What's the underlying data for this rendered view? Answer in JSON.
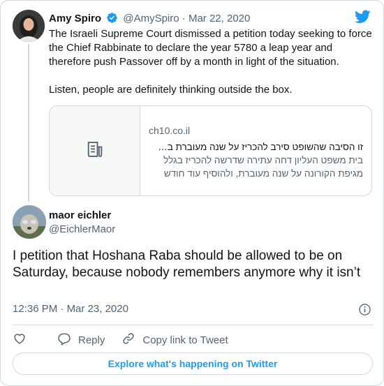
{
  "original_tweet": {
    "author_name": "Amy Spiro",
    "handle": "@AmySpiro",
    "separator": "·",
    "date": "Mar 22, 2020",
    "text": "The Israeli Supreme Court dismissed a petition today seeking to force the Chief Rabbinate to declare the year 5780 a leap year and therefore push Passover off by a month in light of the situation.\n\nListen, people are definitely thinking outside the box.",
    "link_card": {
      "domain": "ch10.co.il",
      "title": "זו הסיבה שהשופט סירב להכריז על שנה מעוברת ב…",
      "description": "בית משפט העליון דחה עתירה שדרשה להכריז בגלל מגיפת הקורונה על שנה מעוברת, ולהוסיף עוד חודש"
    }
  },
  "reply_tweet": {
    "author_name": "maor eichler",
    "handle": "@EichlerMaor",
    "text": "I petition that Hoshana Raba should be allowed to be on Saturday, because nobody remembers anymore why it isn’t",
    "time": "12:36 PM",
    "separator": "·",
    "date": "Mar 23, 2020"
  },
  "actions": {
    "reply_label": "Reply",
    "copy_link_label": "Copy link to Tweet"
  },
  "explore_label": "Explore what's happening on Twitter",
  "icons": {
    "verified": "verified-badge-icon",
    "bird": "twitter-bird-icon",
    "link_preview": "article-icon",
    "info": "info-icon",
    "like": "heart-icon",
    "reply": "speech-bubble-icon",
    "copy_link": "link-icon"
  },
  "colors": {
    "brand_blue": "#1d9bf0",
    "text": "#0f1419",
    "muted": "#536471",
    "border": "#cfd9de"
  }
}
